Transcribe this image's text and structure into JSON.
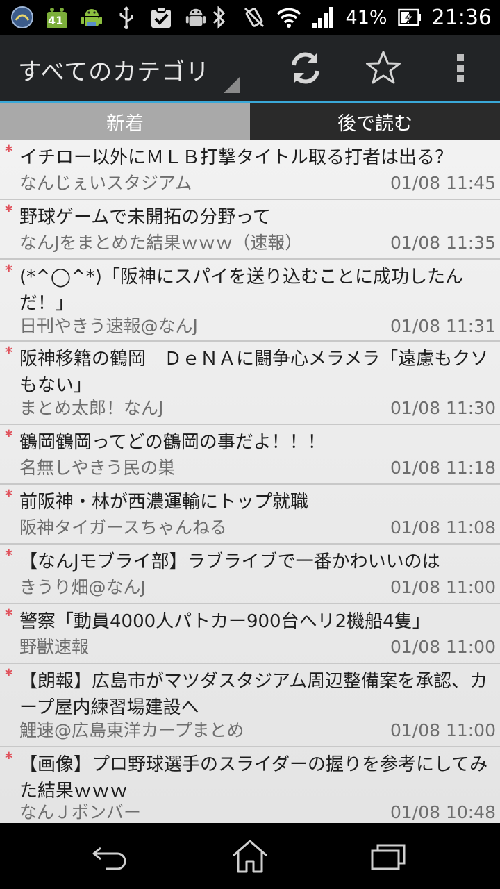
{
  "status_bar": {
    "notif_badge": "41",
    "battery_percent": "41%",
    "clock": "21:36"
  },
  "action_bar": {
    "title": "すべてのカテゴリ"
  },
  "tabs": [
    {
      "label": "新着",
      "selected": true
    },
    {
      "label": "後で読む",
      "selected": false
    }
  ],
  "colors": {
    "accent": "#3aa8d8",
    "unread_marker": "#e0505a"
  },
  "items": [
    {
      "marker": "*",
      "title": "イチロー以外にＭＬＢ打撃タイトル取る打者は出る？",
      "source": "なんじぇいスタジアム",
      "date": "01/08 11:45"
    },
    {
      "marker": "*",
      "title": "野球ゲームで未開拓の分野って",
      "source": "なんJをまとめた結果ｗｗｗ（速報）",
      "date": "01/08 11:35"
    },
    {
      "marker": "*",
      "title": "(*^◯^*)「阪神にスパイを送り込むことに成功したんだ！」",
      "source": "日刊やきう速報@なんJ",
      "date": "01/08 11:31"
    },
    {
      "marker": "*",
      "title": "阪神移籍の鶴岡　ＤｅＮＡに闘争心メラメラ「遠慮もクソもない」",
      "source": "まとめ太郎！なんJ",
      "date": "01/08 11:30"
    },
    {
      "marker": "*",
      "title": "鶴岡鶴岡ってどの鶴岡の事だよ！！！",
      "source": "名無しやきう民の巣",
      "date": "01/08 11:18"
    },
    {
      "marker": "*",
      "title": "前阪神・林が西濃運輸にトップ就職",
      "source": "阪神タイガースちゃんねる",
      "date": "01/08 11:08"
    },
    {
      "marker": "*",
      "title": "【なんJモブライ部】ラブライブで一番かわいいのは",
      "source": "きうり畑@なんJ",
      "date": "01/08 11:00"
    },
    {
      "marker": "*",
      "title": "警察「動員4000人パトカー900台ヘリ2機船4隻」",
      "source": "野獣速報",
      "date": "01/08 11:00"
    },
    {
      "marker": "*",
      "title": "【朗報】広島市がマツダスタジアム周辺整備案を承認、カープ屋内練習場建設へ",
      "source": "鯉速@広島東洋カープまとめ",
      "date": "01/08 11:00"
    },
    {
      "marker": "*",
      "title": "【画像】プロ野球選手のスライダーの握りを参考にしてみた結果ｗｗｗ",
      "source": "なんＪボンバー",
      "date": "01/08 10:48"
    }
  ]
}
